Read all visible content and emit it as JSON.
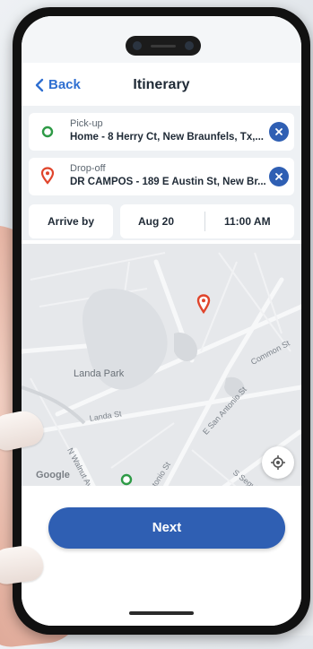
{
  "header": {
    "back_label": "Back",
    "title": "Itinerary"
  },
  "pickup": {
    "label": "Pick-up",
    "value": "Home - 8 Herry Ct, New Braunfels, Tx,..."
  },
  "dropoff": {
    "label": "Drop-off",
    "value": "DR CAMPOS - 189 E Austin St, New Br..."
  },
  "schedule": {
    "mode": "Arrive by",
    "date": "Aug 20",
    "time": "11:00 AM"
  },
  "map": {
    "labels": {
      "park": "Landa Park",
      "landa_st": "Landa St",
      "common_st": "Common St",
      "e_san_antonio": "E San Antonio St",
      "walnut": "N Walnut Ave",
      "san_antonio": "San Antonio St",
      "seguin": "S Seguin Ave"
    },
    "attribution": "Google"
  },
  "actions": {
    "next_label": "Next"
  },
  "colors": {
    "accent": "#2f5fb3",
    "link": "#2f6fd1",
    "pickup": "#2e9a46",
    "dropoff": "#e0452c"
  },
  "icons": [
    "chevron-left-icon",
    "pickup-circle-icon",
    "dropoff-pin-icon",
    "close-icon",
    "locate-icon"
  ]
}
